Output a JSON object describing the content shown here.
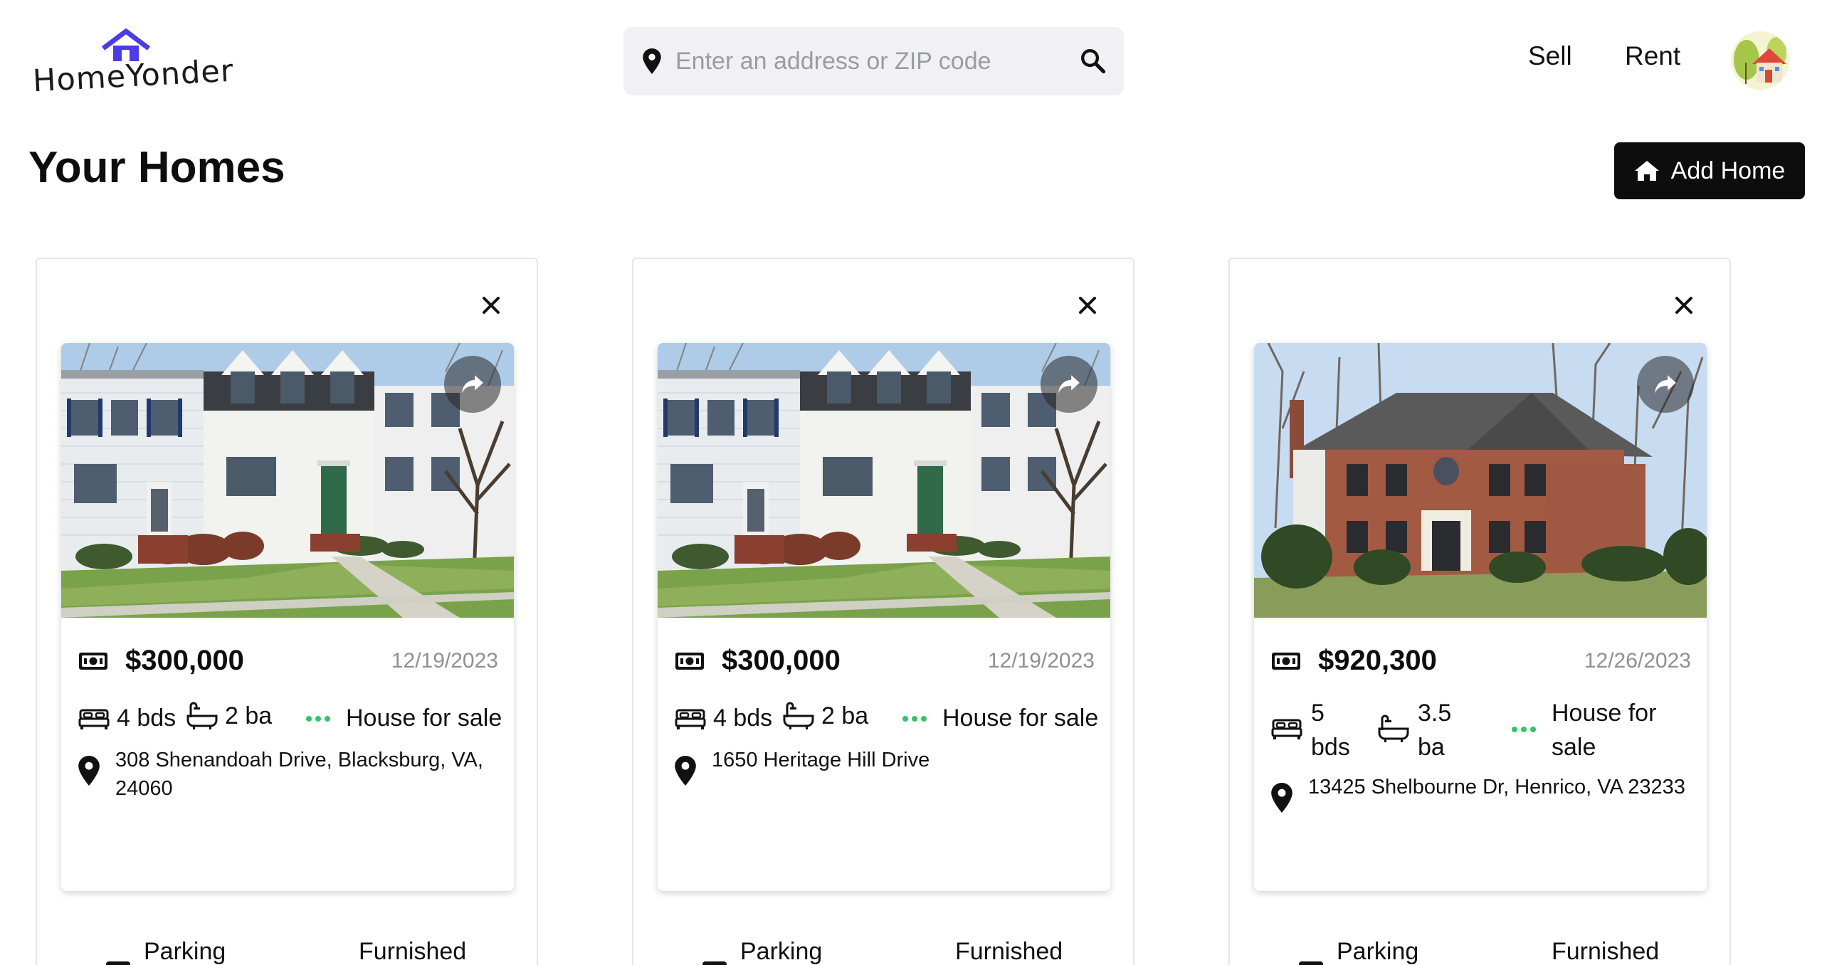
{
  "header": {
    "logo_text": "HomeYonder",
    "search_placeholder": "Enter an address or ZIP code",
    "nav": {
      "sell": "Sell",
      "rent": "Rent"
    }
  },
  "page": {
    "title": "Your Homes",
    "add_button": "Add Home"
  },
  "homes": [
    {
      "price": "$300,000",
      "date": "12/19/2023",
      "beds": "4 bds",
      "baths": "2 ba",
      "status": "House for sale",
      "address": "308 Shenandoah Drive, Blacksburg, VA, 24060",
      "amenities": [
        "Parking",
        "Furnished"
      ]
    },
    {
      "price": "$300,000",
      "date": "12/19/2023",
      "beds": "4 bds",
      "baths": "2 ba",
      "status": "House for sale",
      "address": "1650 Heritage Hill Drive",
      "amenities": [
        "Parking",
        "Furnished"
      ]
    },
    {
      "price": "$920,300",
      "date": "12/26/2023",
      "beds_num": "5",
      "beds_unit": "bds",
      "baths_num": "3.5",
      "baths_unit": "ba",
      "status_line1": "House for",
      "status_line2": "sale",
      "address": "13425 Shelbourne Dr, Henrico, VA 23233",
      "amenities": [
        "Parking",
        "Furnished"
      ]
    }
  ],
  "colors": {
    "logo_roof": "#4a3de6",
    "status_dot": "#34c36a",
    "button_bg": "#0d0d0d",
    "search_bg": "#f1f1f3"
  },
  "icons": [
    "house-logo-icon",
    "map-pin-icon",
    "search-icon",
    "avatar-house-icon",
    "home-icon",
    "close-icon",
    "share-icon",
    "money-icon",
    "bed-icon",
    "bath-icon",
    "dots-icon",
    "parking-icon",
    "sofa-icon"
  ]
}
